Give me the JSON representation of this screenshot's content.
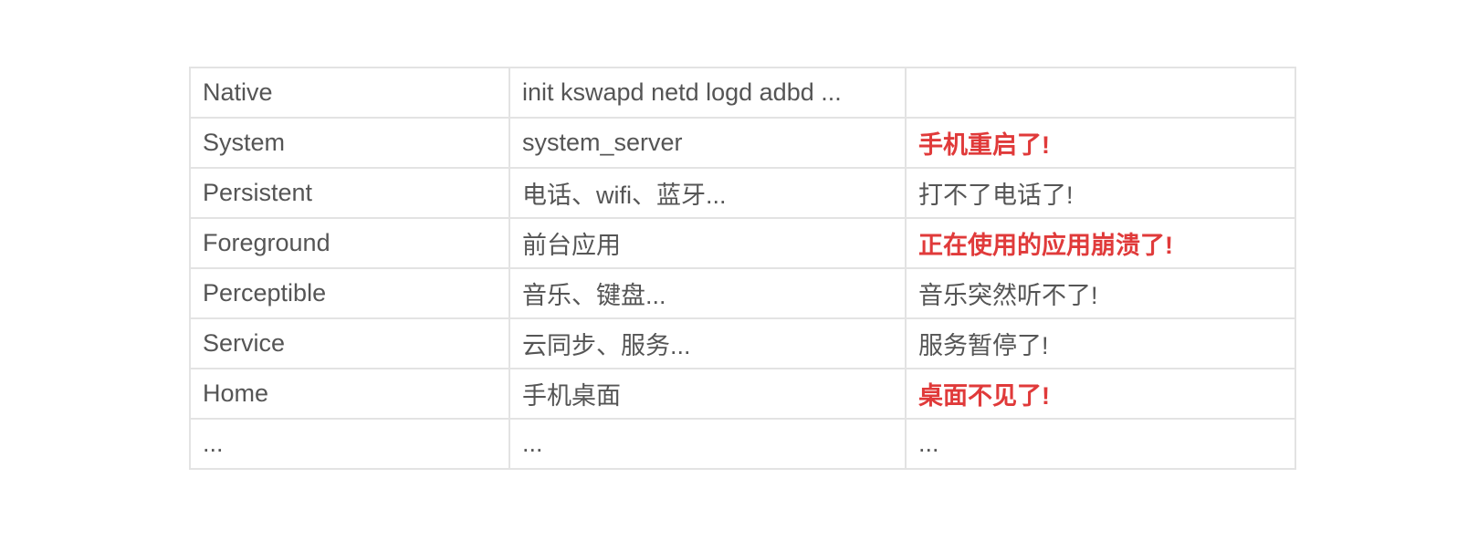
{
  "table": {
    "rows": [
      {
        "level": "Native",
        "example": "init kswapd netd logd adbd ...",
        "impact": "",
        "severe": false
      },
      {
        "level": "System",
        "example": "system_server",
        "impact": "手机重启了!",
        "severe": true
      },
      {
        "level": "Persistent",
        "example": "电话、wifi、蓝牙...",
        "impact": "打不了电话了!",
        "severe": false
      },
      {
        "level": "Foreground",
        "example": "前台应用",
        "impact": "正在使用的应用崩溃了!",
        "severe": true
      },
      {
        "level": "Perceptible",
        "example": "音乐、键盘...",
        "impact": "音乐突然听不了!",
        "severe": false
      },
      {
        "level": "Service",
        "example": "云同步、服务...",
        "impact": "服务暂停了!",
        "severe": false
      },
      {
        "level": "Home",
        "example": "手机桌面",
        "impact": "桌面不见了!",
        "severe": true
      },
      {
        "level": "...",
        "example": "...",
        "impact": "...",
        "severe": false
      }
    ],
    "colors": {
      "text": "#555555",
      "severe": "#e03a3a",
      "border": "#e3e3e3"
    }
  }
}
